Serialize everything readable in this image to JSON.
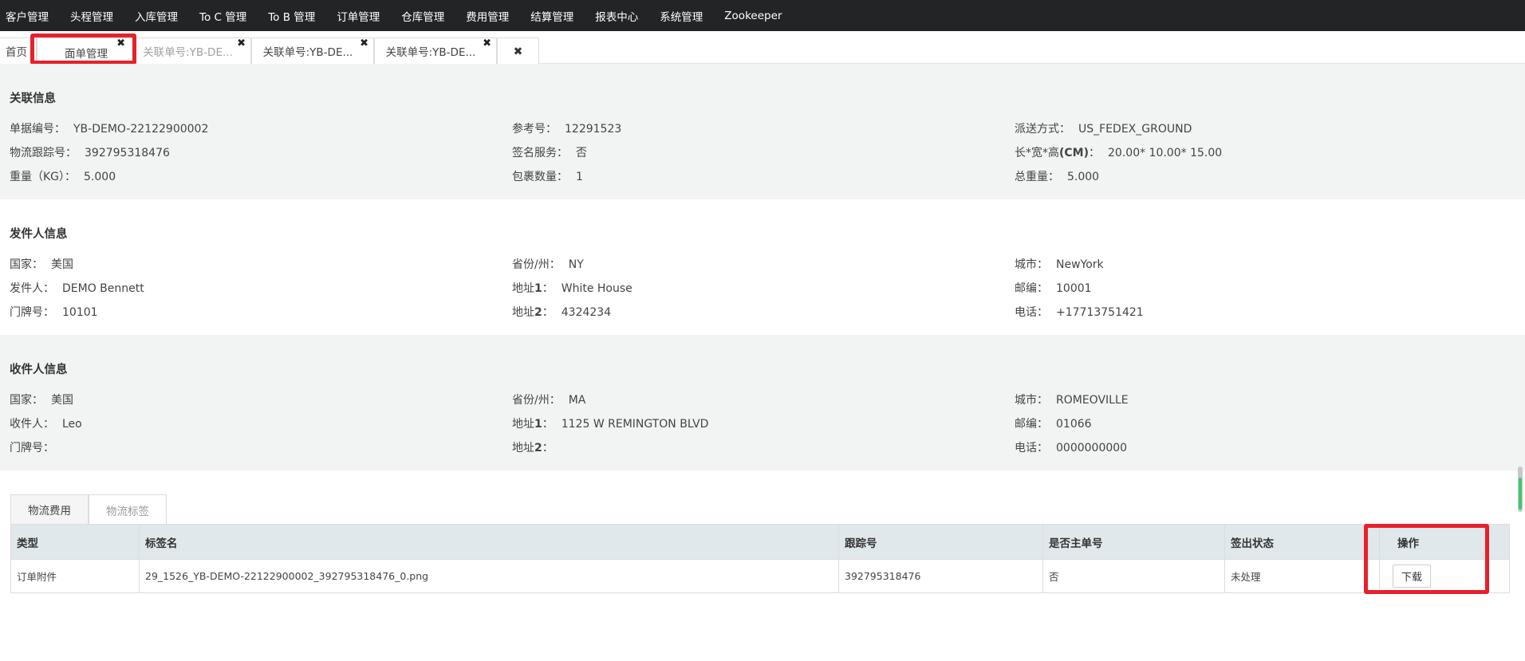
{
  "nav": [
    "客户管理",
    "头程管理",
    "入库管理",
    "To C 管理",
    "To B 管理",
    "订单管理",
    "仓库管理",
    "费用管理",
    "结算管理",
    "报表中心",
    "系统管理",
    "Zookeeper"
  ],
  "tabs": [
    {
      "label": "首页"
    },
    {
      "label": "面单管理"
    },
    {
      "label": "关联单号:YB-DE..."
    },
    {
      "label": "关联单号:YB-DE..."
    },
    {
      "label": "关联单号:YB-DE..."
    }
  ],
  "close_glyph": "✖",
  "related": {
    "title": "关联信息",
    "f1": {
      "k": "单据编号：",
      "v": "YB-DEMO-22122900002"
    },
    "f2": {
      "k": "参考号：",
      "v": "12291523"
    },
    "f3": {
      "k": "派送方式：",
      "v": "US_FEDEX_GROUND"
    },
    "f4": {
      "k": "物流跟踪号：",
      "v": "392795318476"
    },
    "f5": {
      "k": "签名服务：",
      "v": "否"
    },
    "f6": {
      "k1": "长*宽*高",
      "k2": "(CM)",
      "k3": "：",
      "v": "20.00* 10.00* 15.00"
    },
    "f7": {
      "k": "重量（KG）：",
      "v": "5.000"
    },
    "f8": {
      "k": "包裹数量：",
      "v": "1"
    },
    "f9": {
      "k": "总重量：",
      "v": "5.000"
    }
  },
  "sender": {
    "title": "发件人信息",
    "f1": {
      "k": "国家：",
      "v": "美国"
    },
    "f2": {
      "k": "省份/州：",
      "v": "NY"
    },
    "f3": {
      "k": "城市：",
      "v": "NewYork"
    },
    "f4": {
      "k": "发件人：",
      "v": "DEMO Bennett"
    },
    "f5": {
      "k1": "地址",
      "k2": "1",
      "k3": "：",
      "v": "White House"
    },
    "f6": {
      "k": "邮编：",
      "v": "10001"
    },
    "f7": {
      "k": "门牌号：",
      "v": "10101"
    },
    "f8": {
      "k1": "地址",
      "k2": "2",
      "k3": "：",
      "v": "4324234"
    },
    "f9": {
      "k": "电话：",
      "v": "+17713751421"
    }
  },
  "receiver": {
    "title": "收件人信息",
    "f1": {
      "k": "国家：",
      "v": "美国"
    },
    "f2": {
      "k": "省份/州：",
      "v": "MA"
    },
    "f3": {
      "k": "城市：",
      "v": "ROMEOVILLE"
    },
    "f4": {
      "k": "收件人：",
      "v": "Leo"
    },
    "f5": {
      "k1": "地址",
      "k2": "1",
      "k3": "：",
      "v": "1125 W REMINGTON BLVD"
    },
    "f6": {
      "k": "邮编：",
      "v": "01066"
    },
    "f7": {
      "k": "门牌号：",
      "v": ""
    },
    "f8": {
      "k1": "地址",
      "k2": "2",
      "k3": "：",
      "v": ""
    },
    "f9": {
      "k": "电话：",
      "v": "0000000000"
    }
  },
  "subtabs": [
    "物流费用",
    "物流标签"
  ],
  "table": {
    "headers": [
      "类型",
      "标签名",
      "跟踪号",
      "是否主单号",
      "签出状态",
      "操作"
    ],
    "row": [
      "订单附件",
      "29_1526_YB-DEMO-22122900002_392795318476_0.png",
      "392795318476",
      "否",
      "未处理"
    ],
    "action": "下载"
  },
  "highlight_color": "#e8202a"
}
